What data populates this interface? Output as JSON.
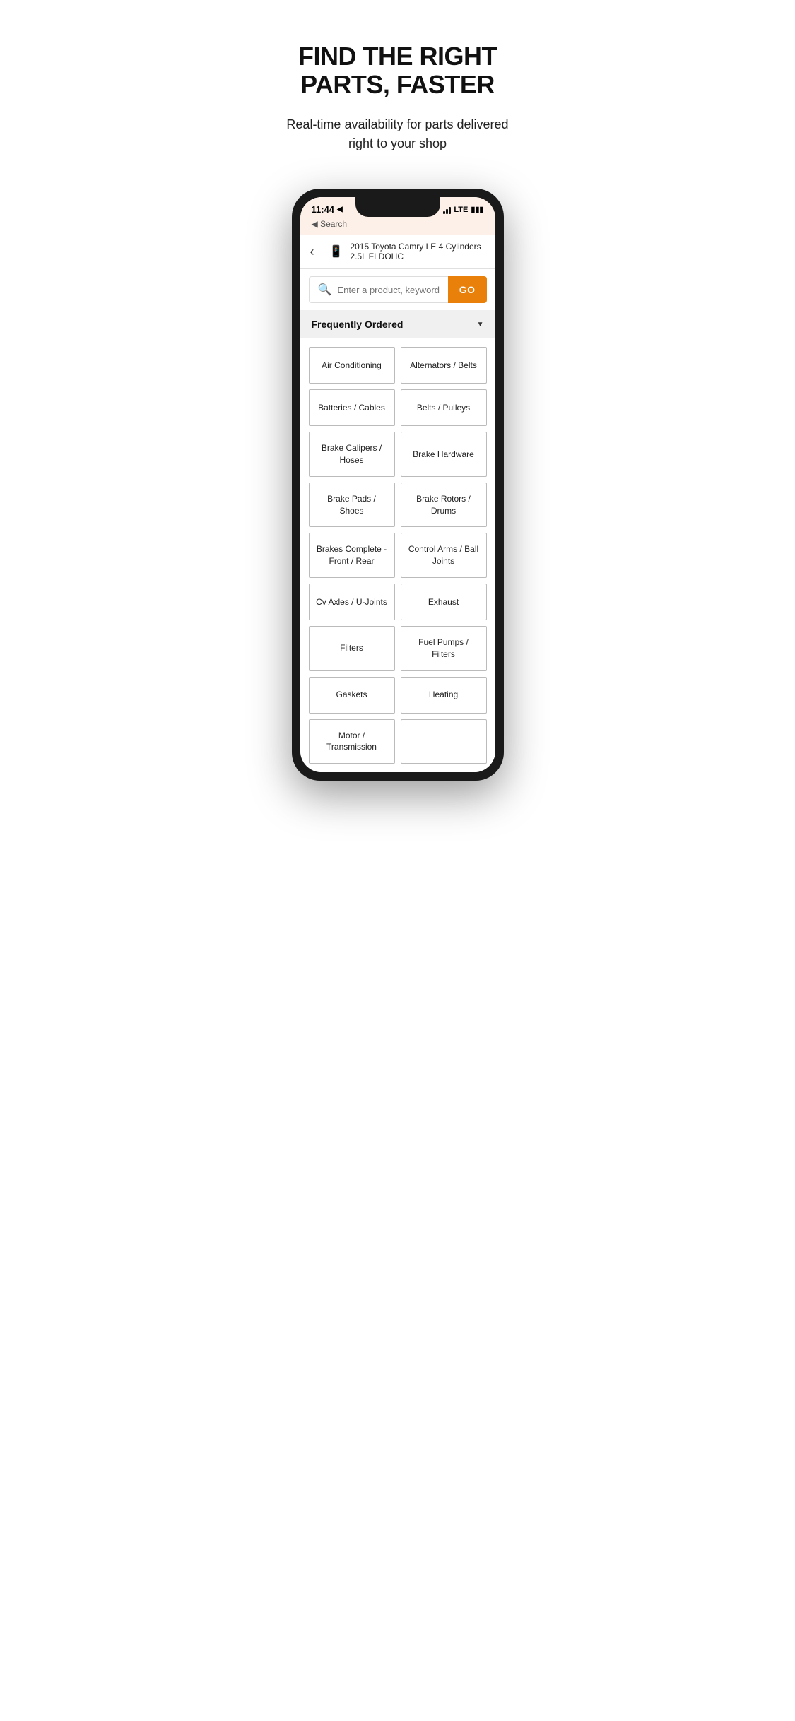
{
  "hero": {
    "title": "FIND THE RIGHT PARTS, FASTER",
    "subtitle": "Real-time availability for parts delivered right to your shop"
  },
  "phone": {
    "statusBar": {
      "time": "11:44",
      "locationIcon": "◀",
      "backLabel": "◀ Search",
      "lte": "LTE"
    },
    "vehicle": {
      "name": "2015 Toyota Camry LE 4 Cylinders 2.5L FI DOHC"
    },
    "search": {
      "placeholder": "Enter a product, keyword, part#, VIN",
      "goLabel": "GO"
    },
    "frequentlyOrdered": {
      "label": "Frequently Ordered"
    },
    "parts": [
      {
        "label": "Air Conditioning"
      },
      {
        "label": "Alternators / Belts"
      },
      {
        "label": "Batteries / Cables"
      },
      {
        "label": "Belts / Pulleys"
      },
      {
        "label": "Brake Calipers / Hoses"
      },
      {
        "label": "Brake Hardware"
      },
      {
        "label": "Brake Pads / Shoes"
      },
      {
        "label": "Brake Rotors / Drums"
      },
      {
        "label": "Brakes Complete - Front / Rear"
      },
      {
        "label": "Control Arms / Ball Joints"
      },
      {
        "label": "Cv Axles / U-Joints"
      },
      {
        "label": "Exhaust"
      },
      {
        "label": "Filters"
      },
      {
        "label": "Fuel Pumps / Filters"
      },
      {
        "label": "Gaskets"
      },
      {
        "label": "Heating"
      },
      {
        "label": "Motor / Transmission"
      },
      {
        "label": ""
      }
    ]
  }
}
